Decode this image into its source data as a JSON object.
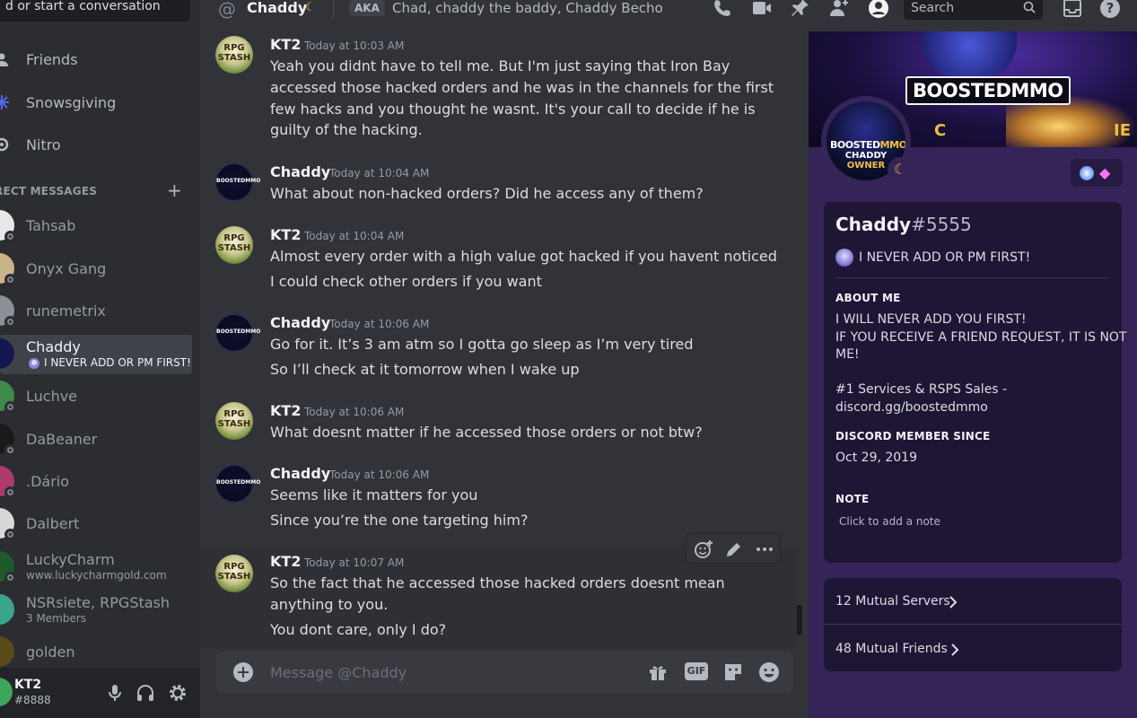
{
  "sidebar": {
    "search_placeholder": "d or start a conversation",
    "nav": [
      {
        "label": "Friends",
        "icon": "friends-icon"
      },
      {
        "label": "Snowsgiving",
        "icon": "snowflake-icon"
      },
      {
        "label": "Nitro",
        "icon": "nitro-icon"
      }
    ],
    "dm_header": "RECT MESSAGES",
    "dms": [
      {
        "name": "Tahsab",
        "sub": ""
      },
      {
        "name": "Onyx Gang",
        "sub": ""
      },
      {
        "name": "runemetrix",
        "sub": ""
      },
      {
        "name": "Chaddy",
        "sub": "I NEVER ADD OR PM FIRST!"
      },
      {
        "name": "Luchve",
        "sub": ""
      },
      {
        "name": "DaBeaner",
        "sub": ""
      },
      {
        "name": ".Dário",
        "sub": ""
      },
      {
        "name": "Dalbert",
        "sub": ""
      },
      {
        "name": "LuckyCharm",
        "sub": "www.luckycharmgold.com"
      },
      {
        "name": "NSRsiete, RPGStash",
        "sub": "3 Members"
      },
      {
        "name": "golden",
        "sub": ""
      }
    ],
    "user": {
      "name": "KT2",
      "tag": "#8888"
    }
  },
  "header": {
    "title": "Chaddy",
    "aka_label": "AKA",
    "aliases": "Chad, chaddy the baddy, Chaddy Becho",
    "search_label": "Search"
  },
  "messages": [
    {
      "author": "KT2",
      "avatar": "RPG STASH",
      "time": "Today at 10:03 AM",
      "lines": [
        "Yeah you didnt have to tell me. But I'm just saying that Iron Bay",
        "accessed those hacked orders and he was in the channels for the first",
        "few hacks and you thought he wasnt. It's your call to decide if he is",
        "guilty of the hacking."
      ]
    },
    {
      "author": "Chaddy",
      "avatar": "BOOSTEDMMO",
      "time": "Today at 10:04 AM",
      "lines": [
        "What about non-hacked orders? Did he access any of them?"
      ]
    },
    {
      "author": "KT2",
      "avatar": "RPG STASH",
      "time": "Today at 10:04 AM",
      "lines": [
        "Almost every order with a high value got hacked if you havent noticed",
        "I could check other orders if you want"
      ]
    },
    {
      "author": "Chaddy",
      "avatar": "BOOSTEDMMO",
      "time": "Today at 10:06 AM",
      "lines": [
        "Go for it. It’s 3 am atm so I gotta go sleep as I’m very tired",
        "So I’ll check at it tomorrow when I wake up"
      ]
    },
    {
      "author": "KT2",
      "avatar": "RPG STASH",
      "time": "Today at 10:06 AM",
      "lines": [
        "What doesnt matter if he accessed those orders or not btw?"
      ]
    },
    {
      "author": "Chaddy",
      "avatar": "BOOSTEDMMO",
      "time": "Today at 10:06 AM",
      "lines": [
        "Seems like it matters for you",
        "Since you’re the one targeting him?"
      ]
    },
    {
      "author": "KT2",
      "avatar": "RPG STASH",
      "time": "Today at 10:07 AM",
      "lines": [
        "So the fact that he accessed those hacked orders doesnt mean",
        "anything to you.",
        "You dont care, only I do?"
      ]
    }
  ],
  "composer": {
    "placeholder": "Message @Chaddy",
    "gif_label": "GIF"
  },
  "profile": {
    "banner_logo": "BOOSTEDMMO",
    "banner_left": "C",
    "banner_right": "IE",
    "avatar_line1_a": "BOOSTED",
    "avatar_line1_b": "MMO",
    "avatar_line2": "CHADDY",
    "avatar_line3": "OWNER",
    "username": "Chaddy",
    "discriminator": "#5555",
    "status": "I NEVER ADD OR PM FIRST!",
    "about_title": "ABOUT ME",
    "about_lines": [
      "I WILL NEVER ADD YOU FIRST!",
      "IF YOU RECEIVE A FRIEND REQUEST, IT IS NOT",
      "ME!",
      "",
      "#1 Services & RSPS Sales -",
      "discord.gg/boostedmmo"
    ],
    "member_since_title": "DISCORD MEMBER SINCE",
    "member_since": "Oct 29, 2019",
    "note_title": "NOTE",
    "note_placeholder": "Click to add a note",
    "mutual_servers": "12 Mutual Servers",
    "mutual_friends": "48 Mutual Friends"
  },
  "colors": {
    "accent": "#5865f2",
    "profile_bg": "#342457",
    "card_bg": "#1f1535",
    "status_idle": "#f0b232"
  }
}
